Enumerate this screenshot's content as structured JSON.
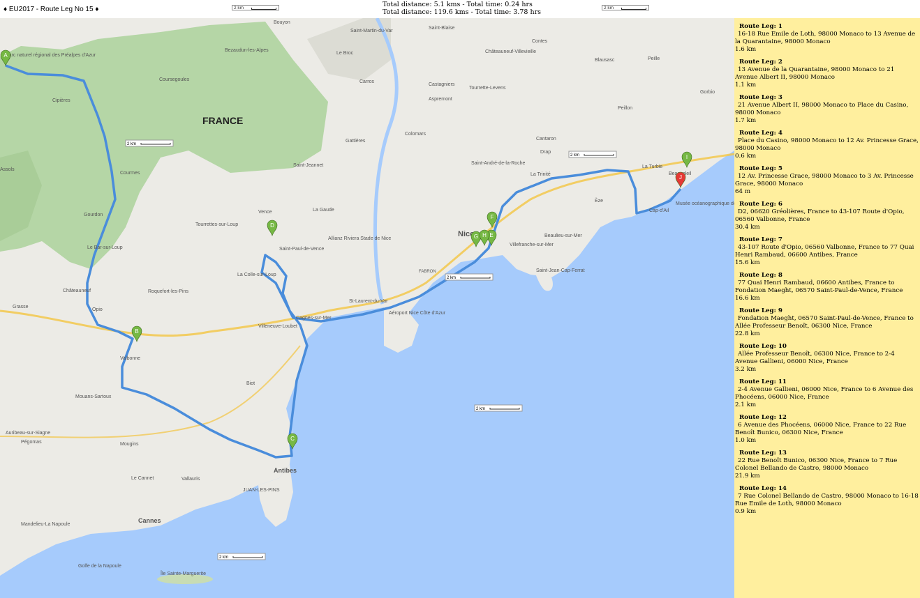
{
  "window": {
    "title": "EU2017 - Route Leg No 15",
    "diamond": "♦"
  },
  "totals": {
    "line1": "Total distance: 5.1 kms  -  Total time: 0.24 hrs",
    "line2": "Total distance: 119.6 kms  -  Total time: 3.78 hrs"
  },
  "scale": {
    "label": "2 km"
  },
  "colors": {
    "water": "#a6cbfc",
    "land": "#ecebe6",
    "park": "#b5d6a6",
    "route": "#4a8ddb",
    "marker": "#76b844",
    "marker_current": "#e53935",
    "panel": "#ffef9e"
  },
  "map": {
    "country_label": "FRANCE",
    "places": [
      "Parc naturel régional des Préalpes d'Azur",
      "Bouyon",
      "Bezaudun-les-Alpes",
      "Le Broc",
      "Saint-Martin-du-Var",
      "Saint-Blaise",
      "Contes",
      "Châteauneuf-Villevieille",
      "Blausasc",
      "Peille",
      "Castagniers",
      "Tourrette-Levens",
      "Aspremont",
      "Carros",
      "Coursegoules",
      "Cipières",
      "Gattières",
      "Colomars",
      "Saint-André-de-la-Roche",
      "Cantaron",
      "Drap",
      "La Trinité",
      "La Turbie",
      "Gorbio",
      "Peillon",
      "Courmes",
      "Saint-Jeannet",
      "Gourdon",
      "Vence",
      "La Gaude",
      "Tourrettes-sur-Loup",
      "Le Bar-sur-Loup",
      "Saint-Paul-de-Vence",
      "La Colle-sur-Loup",
      "Châteauneuf",
      "Roquefort-les-Pins",
      "Opio",
      "Grasse",
      "Valbonne",
      "Mouans-Sartoux",
      "Biot",
      "Villeneuve-Loubet",
      "Cagnes-sur-Mer",
      "St-Laurent-du-Var",
      "Aéroport Nice Côte d'Azur",
      "Allianz Riviera Stade de Nice",
      "Nice",
      "Villefranche-sur-Mer",
      "Beaulieu-sur-Mer",
      "Saint-Jean-Cap-Ferrat",
      "Èze",
      "Cap-d'Ail",
      "Beausoleil",
      "Musée océanographique de Monaco",
      "Mougins",
      "Le Cannet",
      "Vallauris",
      "Antibes",
      "JUAN-LES-PINS",
      "Cannes",
      "Mandelieu-La Napoule",
      "Pégomas",
      "Auribeau-sur-Siagne",
      "Île Sainte-Marguerite",
      "Golfe de la Napoule",
      "FABRON",
      "Assols"
    ],
    "markers": [
      "A",
      "B",
      "C",
      "D",
      "E",
      "F",
      "G",
      "H",
      "I",
      "J"
    ]
  },
  "legs": [
    {
      "title": "Route Leg: 1",
      "desc": "16-18 Rue Emile de Loth, 98000 Monaco to 13 Avenue de la Quarantaine, 98000 Monaco",
      "dist": "1.6 km"
    },
    {
      "title": "Route Leg: 2",
      "desc": "13 Avenue de la Quarantaine, 98000 Monaco to 21 Avenue Albert II, 98000 Monaco",
      "dist": "1.1 km"
    },
    {
      "title": "Route Leg: 3",
      "desc": "21 Avenue Albert II, 98000 Monaco to Place du Casino, 98000 Monaco",
      "dist": "1.7 km"
    },
    {
      "title": "Route Leg: 4",
      "desc": "Place du Casino, 98000 Monaco to 12 Av. Princesse Grace, 98000 Monaco",
      "dist": "0.6 km"
    },
    {
      "title": "Route Leg: 5",
      "desc": "12 Av. Princesse Grace, 98000 Monaco to 3 Av. Princesse Grace, 98000 Monaco",
      "dist": "64 m"
    },
    {
      "title": "Route Leg: 6",
      "desc": "D2, 06620 Gréolières, France to 43-107 Route d'Opio, 06560 Valbonne, France",
      "dist": "30.4 km"
    },
    {
      "title": "Route Leg: 7",
      "desc": "43-107 Route d'Opio, 06560 Valbonne, France to 77 Quai Henri Rambaud, 06600 Antibes, France",
      "dist": "15.6 km"
    },
    {
      "title": "Route Leg: 8",
      "desc": "77 Quai Henri Rambaud, 06600 Antibes, France to Fondation Maeght, 06570 Saint-Paul-de-Vence, France",
      "dist": "16.6 km"
    },
    {
      "title": "Route Leg: 9",
      "desc": "Fondation Maeght, 06570 Saint-Paul-de-Vence, France to Allée Professeur Benoît, 06300 Nice, France",
      "dist": "22.8 km"
    },
    {
      "title": "Route Leg: 10",
      "desc": "Allée Professeur Benoît, 06300 Nice, France to 2-4 Avenue Gallieni, 06000 Nice, France",
      "dist": "3.2 km"
    },
    {
      "title": "Route Leg: 11",
      "desc": "2-4 Avenue Gallieni, 06000 Nice, France to 6 Avenue des Phocéens, 06000 Nice, France",
      "dist": "2.1 km"
    },
    {
      "title": "Route Leg: 12",
      "desc": "6 Avenue des Phocéens, 06000 Nice, France to 22 Rue Benoît Bunico, 06300 Nice, France",
      "dist": "1.0 km"
    },
    {
      "title": "Route Leg: 13",
      "desc": "22 Rue Benoît Bunico, 06300 Nice, France to 7 Rue Colonel Bellando de Castro, 98000 Monaco",
      "dist": "21.9 km"
    },
    {
      "title": "Route Leg: 14",
      "desc": "7 Rue Colonel Bellando de Castro, 98000 Monaco to 16-18 Rue Emile de Loth, 98000 Monaco",
      "dist": "0.9 km"
    }
  ]
}
